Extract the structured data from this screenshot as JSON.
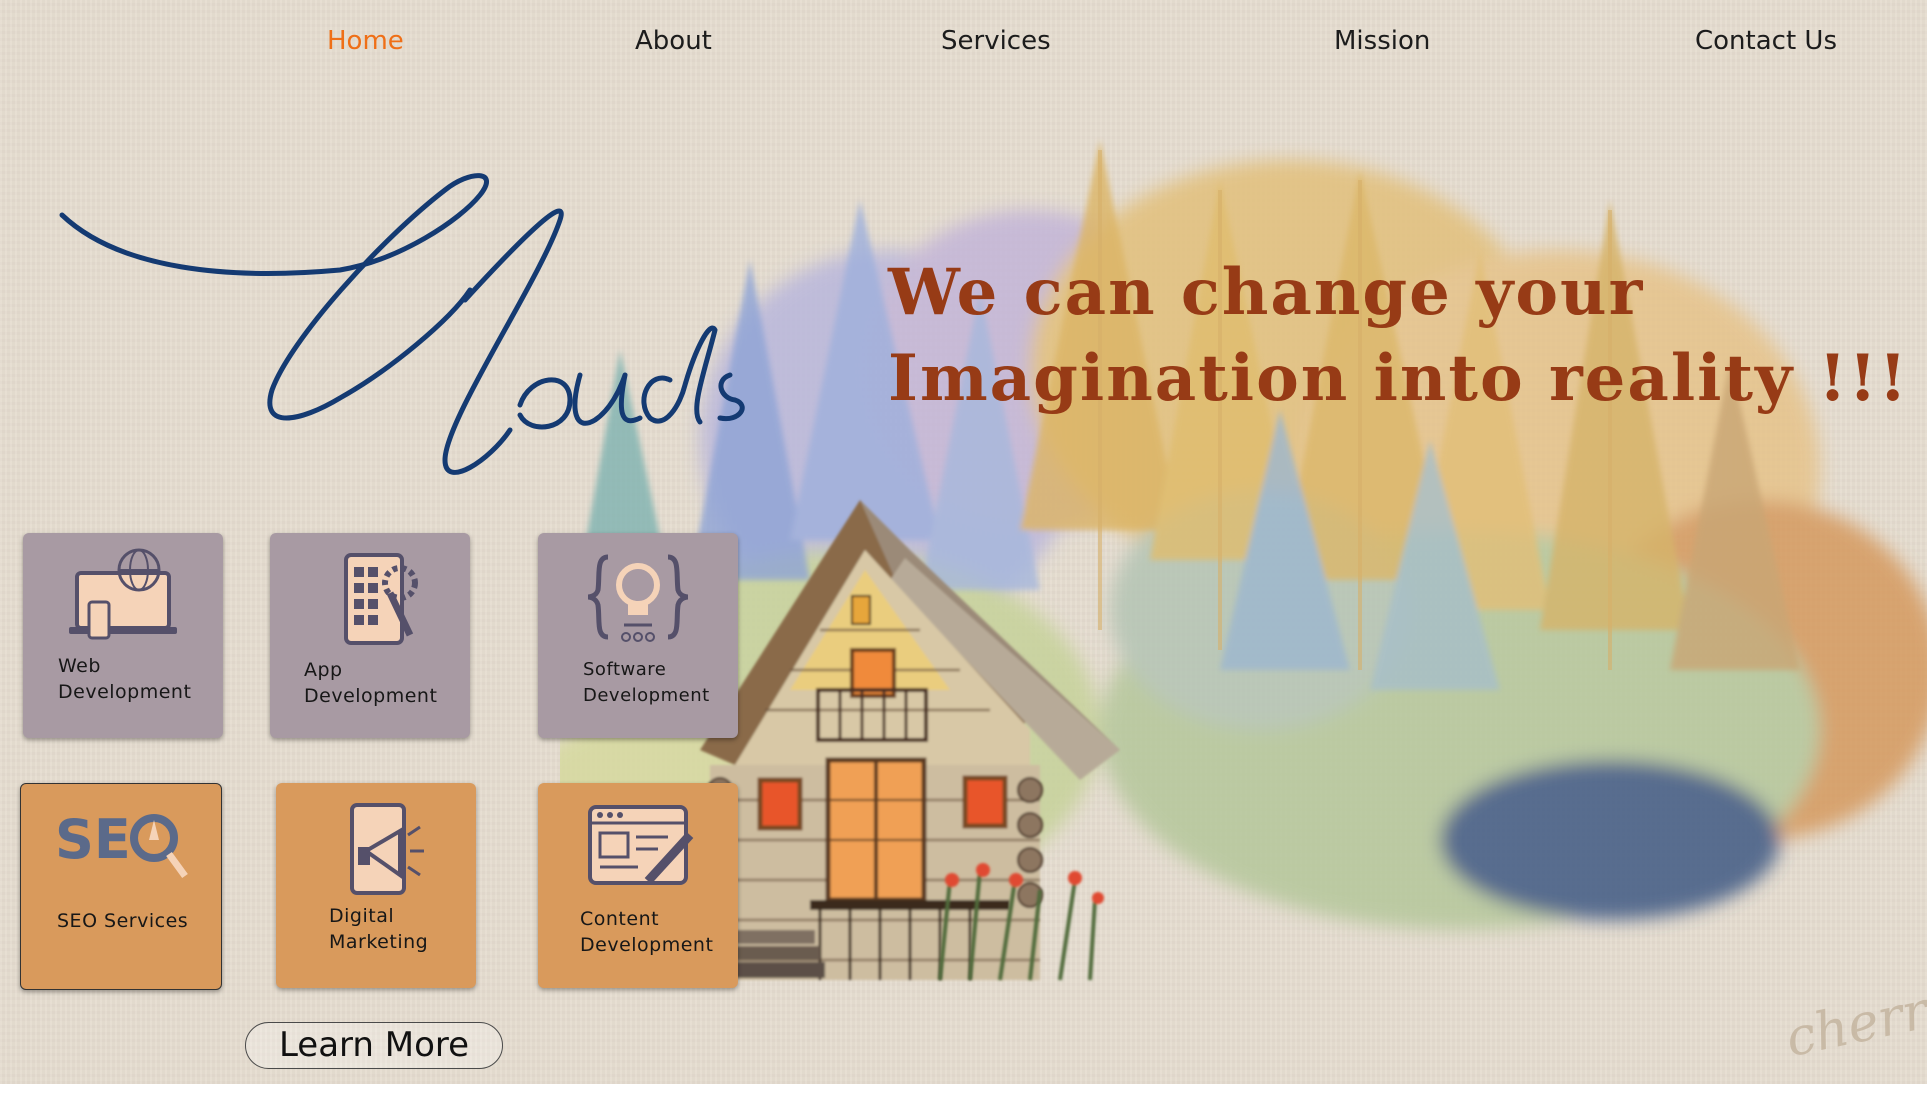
{
  "nav": {
    "items": [
      {
        "label": "Home",
        "active": true
      },
      {
        "label": "About",
        "active": false
      },
      {
        "label": "Services",
        "active": false
      },
      {
        "label": "Mission",
        "active": false
      },
      {
        "label": "Contact Us",
        "active": false
      }
    ],
    "active_color": "#ef6f17"
  },
  "brand": {
    "logo_script": "Clouds"
  },
  "hero": {
    "tagline_line1": "We can change your",
    "tagline_line2": "Imagination into reality !!!",
    "tagline_color": "#973b16"
  },
  "services": [
    {
      "label": "Web Development",
      "icon": "globe-laptop-icon",
      "color": "#a89aa3"
    },
    {
      "label": "App Development",
      "icon": "app-tablet-gear-icon",
      "color": "#a89aa3"
    },
    {
      "label": "Software Development",
      "icon": "bulb-braces-icon",
      "color": "#a89aa3"
    },
    {
      "label": "SEO Services",
      "icon": "seo-magnifier-icon",
      "color": "#d99a5c"
    },
    {
      "label": "Digital Marketing",
      "icon": "megaphone-phone-icon",
      "color": "#d99a5c"
    },
    {
      "label": "Content Development",
      "icon": "browser-pen-icon",
      "color": "#d99a5c"
    }
  ],
  "cta": {
    "learn_more_label": "Learn More"
  },
  "signature_text": "cherry"
}
